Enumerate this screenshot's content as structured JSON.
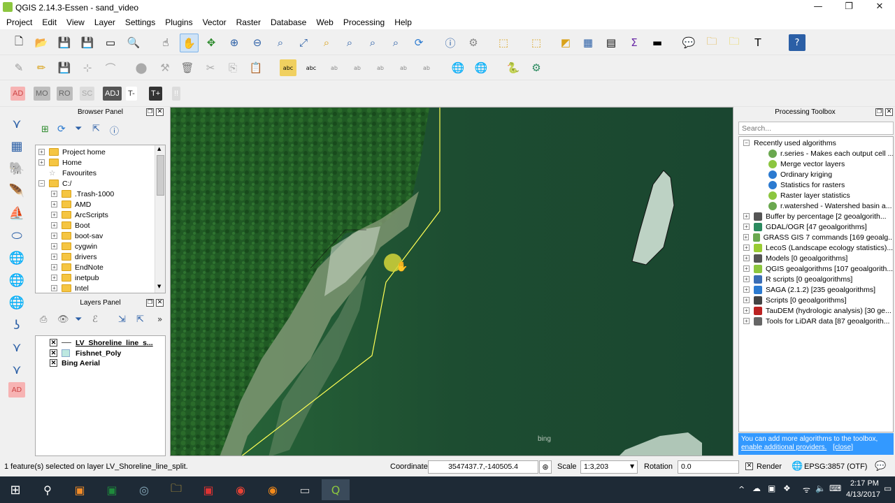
{
  "window": {
    "title": "QGIS 2.14.3-Essen - sand_video",
    "minimize": "—",
    "restore": "❐",
    "close": "✕"
  },
  "menu": [
    "Project",
    "Edit",
    "View",
    "Layer",
    "Settings",
    "Plugins",
    "Vector",
    "Raster",
    "Database",
    "Web",
    "Processing",
    "Help"
  ],
  "toolbar3": {
    "labels": [
      "AD",
      "MO",
      "RO",
      "SC",
      "ADJ",
      "T-",
      "T+",
      "!!"
    ]
  },
  "browser": {
    "title": "Browser Panel",
    "items": [
      {
        "label": "Project home",
        "indent": 0,
        "expand": "+",
        "type": "folder"
      },
      {
        "label": "Home",
        "indent": 0,
        "expand": "+",
        "type": "folder"
      },
      {
        "label": "Favourites",
        "indent": 0,
        "expand": "",
        "type": "star"
      },
      {
        "label": "C:/",
        "indent": 0,
        "expand": "−",
        "type": "folder"
      },
      {
        "label": ".Trash-1000",
        "indent": 1,
        "expand": "+",
        "type": "folder"
      },
      {
        "label": "AMD",
        "indent": 1,
        "expand": "+",
        "type": "folder"
      },
      {
        "label": "ArcScripts",
        "indent": 1,
        "expand": "+",
        "type": "folder"
      },
      {
        "label": "Boot",
        "indent": 1,
        "expand": "+",
        "type": "folder"
      },
      {
        "label": "boot-sav",
        "indent": 1,
        "expand": "+",
        "type": "folder"
      },
      {
        "label": "cygwin",
        "indent": 1,
        "expand": "+",
        "type": "folder"
      },
      {
        "label": "drivers",
        "indent": 1,
        "expand": "+",
        "type": "folder"
      },
      {
        "label": "EndNote",
        "indent": 1,
        "expand": "+",
        "type": "folder"
      },
      {
        "label": "inetpub",
        "indent": 1,
        "expand": "+",
        "type": "folder"
      },
      {
        "label": "Intel",
        "indent": 1,
        "expand": "+",
        "type": "folder"
      }
    ]
  },
  "layers": {
    "title": "Layers Panel",
    "items": [
      {
        "label": "LV_Shoreline_line_s...",
        "bold": true,
        "underline": true,
        "symbol": "line"
      },
      {
        "label": "Fishnet_Poly",
        "bold": true,
        "underline": false,
        "symbol": "poly"
      },
      {
        "label": "Bing Aerial",
        "bold": true,
        "underline": false,
        "symbol": "none"
      }
    ]
  },
  "processing": {
    "title": "Processing Toolbox",
    "search_placeholder": "Search...",
    "recent_header": "Recently used algorithms",
    "recent": [
      {
        "label": "r.series - Makes each output cell ...",
        "icon": "grass"
      },
      {
        "label": "Merge vector layers",
        "icon": "qgis"
      },
      {
        "label": "Ordinary kriging",
        "icon": "saga"
      },
      {
        "label": "Statistics for rasters",
        "icon": "saga"
      },
      {
        "label": "Raster layer statistics",
        "icon": "qgis-stat"
      },
      {
        "label": "r.watershed - Watershed basin a...",
        "icon": "grass"
      }
    ],
    "groups": [
      {
        "label": "Buffer by percentage [2 geoalgorith...",
        "icon": "model"
      },
      {
        "label": "GDAL/OGR [47 geoalgorithms]",
        "icon": "gdal"
      },
      {
        "label": "GRASS GIS 7 commands [169 geoalg...",
        "icon": "grass"
      },
      {
        "label": "LecoS (Landscape ecology statistics)...",
        "icon": "lecos"
      },
      {
        "label": "Models [0 geoalgorithms]",
        "icon": "model"
      },
      {
        "label": "QGIS geoalgorithms [107 geoalgorith...",
        "icon": "qgis"
      },
      {
        "label": "R scripts [0 geoalgorithms]",
        "icon": "r"
      },
      {
        "label": "SAGA (2.1.2) [235 geoalgorithms]",
        "icon": "saga"
      },
      {
        "label": "Scripts [0 geoalgorithms]",
        "icon": "script"
      },
      {
        "label": "TauDEM (hydrologic analysis) [30 ge...",
        "icon": "taudem"
      },
      {
        "label": "Tools for LiDAR data [87 geoalgorith...",
        "icon": "lidar"
      }
    ],
    "notice_text": "You can add more algorithms to the toolbox,",
    "notice_link": "enable additional providers.",
    "notice_close": "[close]"
  },
  "map": {
    "watermark": "bing"
  },
  "status": {
    "message": "1 feature(s) selected on layer LV_Shoreline_line_split.",
    "coordinate_label": "Coordinate",
    "coordinate_value": "3547437.7,-140505.4",
    "scale_label": "Scale",
    "scale_value": "1:3,203",
    "rotation_label": "Rotation",
    "rotation_value": "0.0",
    "render_label": "Render",
    "crs": "EPSG:3857 (OTF)"
  },
  "taskbar": {
    "time": "2:17 PM",
    "date": "4/13/2017"
  },
  "colors": {
    "selection_line": "#ffff55",
    "map_water": "#1f4d32",
    "forest": "#1f5a25",
    "accent": "#0078d7"
  }
}
